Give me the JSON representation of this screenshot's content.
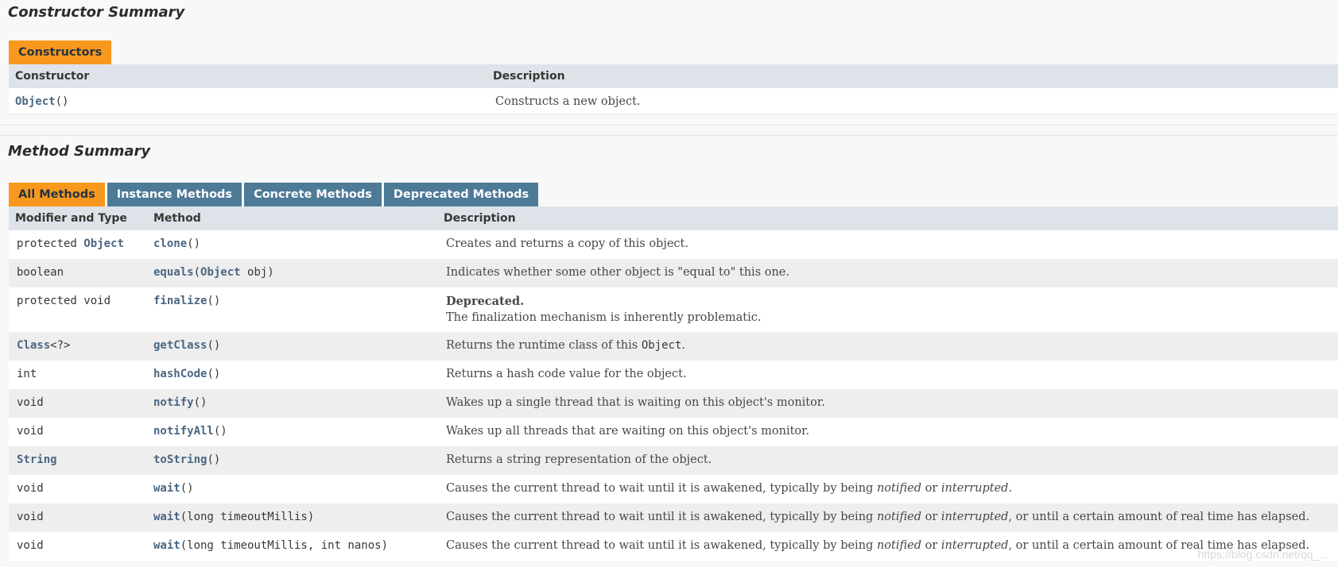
{
  "constructor_summary": {
    "title": "Constructor Summary",
    "tab": "Constructors",
    "headers": {
      "constructor": "Constructor",
      "description": "Description"
    },
    "rows": [
      {
        "name": "Object",
        "params": "()",
        "description": "Constructs a new object."
      }
    ]
  },
  "method_summary": {
    "title": "Method Summary",
    "tabs": [
      "All Methods",
      "Instance Methods",
      "Concrete Methods",
      "Deprecated Methods"
    ],
    "headers": {
      "modifier": "Modifier and Type",
      "method": "Method",
      "description": "Description"
    },
    "rows": [
      {
        "mod_prefix": "protected ",
        "mod_link": "Object",
        "mod_suffix": "",
        "method": "clone",
        "params": "()",
        "description": "Creates and returns a copy of this object."
      },
      {
        "mod_prefix": "boolean",
        "mod_link": "",
        "mod_suffix": "",
        "method": "equals",
        "params_open": "(",
        "params_link": "Object",
        "params_rest": " obj)",
        "description": "Indicates whether some other object is \"equal to\" this one."
      },
      {
        "mod_prefix": "protected void",
        "mod_link": "",
        "mod_suffix": "",
        "method": "finalize",
        "params": "()",
        "deprecated": "Deprecated.",
        "description": "The finalization mechanism is inherently problematic."
      },
      {
        "mod_prefix": "",
        "mod_link": "Class",
        "mod_suffix": "<?>",
        "method": "getClass",
        "params": "()",
        "desc_pre": "Returns the runtime class of this ",
        "desc_code": "Object",
        "desc_post": "."
      },
      {
        "mod_prefix": "int",
        "mod_link": "",
        "mod_suffix": "",
        "method": "hashCode",
        "params": "()",
        "description": "Returns a hash code value for the object."
      },
      {
        "mod_prefix": "void",
        "mod_link": "",
        "mod_suffix": "",
        "method": "notify",
        "params": "()",
        "description": "Wakes up a single thread that is waiting on this object's monitor."
      },
      {
        "mod_prefix": "void",
        "mod_link": "",
        "mod_suffix": "",
        "method": "notifyAll",
        "params": "()",
        "description": "Wakes up all threads that are waiting on this object's monitor."
      },
      {
        "mod_prefix": "",
        "mod_link": "String",
        "mod_suffix": "",
        "method": "toString",
        "params": "()",
        "description": "Returns a string representation of the object."
      },
      {
        "mod_prefix": "void",
        "mod_link": "",
        "mod_suffix": "",
        "method": "wait",
        "params": "()",
        "desc_pre": "Causes the current thread to wait until it is awakened, typically by being ",
        "desc_i1": "notified",
        "desc_mid": " or ",
        "desc_i2": "interrupted",
        "desc_post": "."
      },
      {
        "mod_prefix": "void",
        "mod_link": "",
        "mod_suffix": "",
        "method": "wait",
        "params": "(long timeoutMillis)",
        "desc_pre": "Causes the current thread to wait until it is awakened, typically by being ",
        "desc_i1": "notified",
        "desc_mid": " or ",
        "desc_i2": "interrupted",
        "desc_post": ", or until a certain amount of real time has elapsed."
      },
      {
        "mod_prefix": "void",
        "mod_link": "",
        "mod_suffix": "",
        "method": "wait",
        "params": "(long timeoutMillis, int nanos)",
        "desc_pre": "Causes the current thread to wait until it is awakened, typically by being ",
        "desc_i1": "notified",
        "desc_mid": " or ",
        "desc_i2": "interrupted",
        "desc_post": ", or until a certain amount of real time has elapsed."
      }
    ]
  },
  "watermark": "https://blog.csdn.net/qq_..."
}
